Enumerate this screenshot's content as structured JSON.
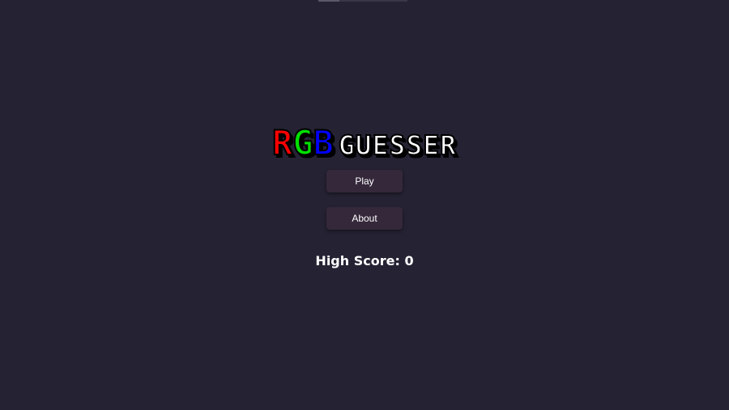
{
  "logo": {
    "letters": [
      {
        "char": "R",
        "color": "#ff0000"
      },
      {
        "char": "G",
        "color": "#00e000"
      },
      {
        "char": "B",
        "color": "#0000ff"
      }
    ],
    "subtitle": "GUESSER"
  },
  "menu": {
    "play_label": "Play",
    "about_label": "About"
  },
  "high_score": {
    "label": "High Score:",
    "value": "0"
  },
  "colors": {
    "background": "#252333",
    "button_bg": "#34283a",
    "text": "#ffffff"
  }
}
